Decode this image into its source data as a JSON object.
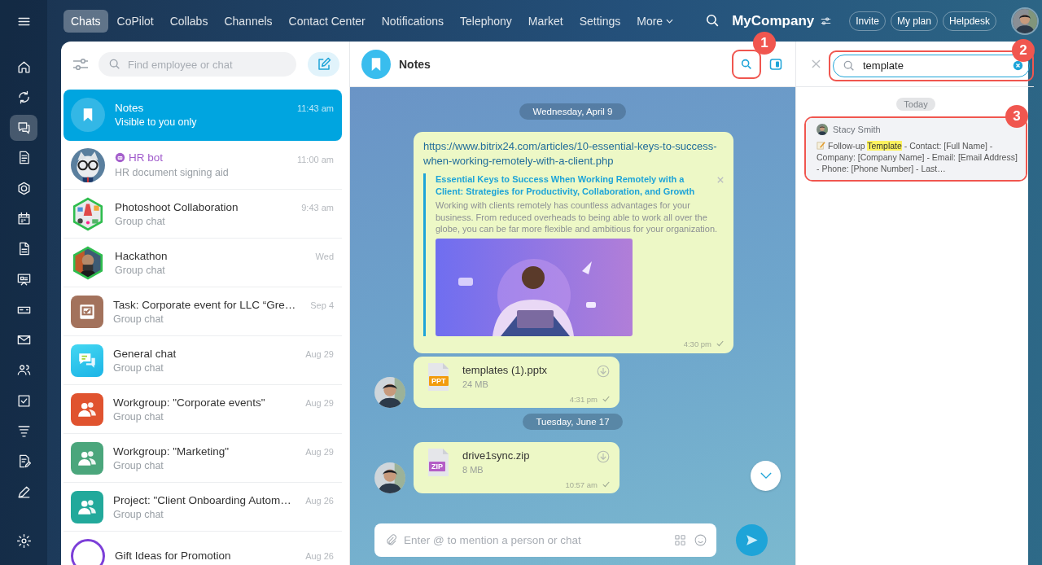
{
  "rail": {
    "items": [
      {
        "kind": "menu",
        "selected": false
      },
      {
        "kind": "home",
        "selected": false
      },
      {
        "kind": "sync",
        "selected": false
      },
      {
        "kind": "chat",
        "selected": true
      },
      {
        "kind": "document",
        "selected": false
      },
      {
        "kind": "hexagon",
        "selected": false
      },
      {
        "kind": "calendar",
        "selected": false
      },
      {
        "kind": "file",
        "selected": false
      },
      {
        "kind": "presentation",
        "selected": false
      },
      {
        "kind": "drive",
        "selected": false
      },
      {
        "kind": "mail",
        "selected": false
      },
      {
        "kind": "people",
        "selected": false
      },
      {
        "kind": "checkbox",
        "selected": false
      },
      {
        "kind": "funnel",
        "selected": false
      },
      {
        "kind": "document-edit",
        "selected": false
      },
      {
        "kind": "pen",
        "selected": false
      },
      {
        "kind": "settings",
        "selected": false
      }
    ]
  },
  "top_nav": {
    "tabs": [
      {
        "label": "Chats",
        "selected": true
      },
      {
        "label": "CoPilot",
        "selected": false
      },
      {
        "label": "Collabs",
        "selected": false
      },
      {
        "label": "Channels",
        "selected": false
      },
      {
        "label": "Contact Center",
        "selected": false
      },
      {
        "label": "Notifications",
        "selected": false
      },
      {
        "label": "Telephony",
        "selected": false
      },
      {
        "label": "Market",
        "selected": false
      },
      {
        "label": "Settings",
        "selected": false
      }
    ],
    "more": "More",
    "company": "MyCompany",
    "buttons": [
      "Invite",
      "My plan",
      "Helpdesk"
    ]
  },
  "chat_list": {
    "search": {
      "placeholder": "Find employee or chat"
    },
    "items": [
      {
        "kind": "notes",
        "title": "Notes",
        "subtitle": "Visible to you only",
        "time": "11:43 am",
        "selected": true
      },
      {
        "kind": "bot",
        "title": "HR bot",
        "subtitle": "HR document signing aid",
        "time": "11:00 am",
        "selected": false
      },
      {
        "kind": "photo-hex",
        "title": "Photoshoot Collaboration",
        "subtitle": "Group chat",
        "time": "9:43 am",
        "selected": false
      },
      {
        "kind": "photo-hex",
        "title": "Hackathon",
        "subtitle": "Group chat",
        "time": "Wed",
        "selected": false
      },
      {
        "kind": "task",
        "color": "#a3725c",
        "title": "Task: Corporate event for LLC “Gre…",
        "subtitle": "Group chat",
        "time": "Sep 4",
        "selected": false
      },
      {
        "kind": "chat-tile",
        "title": "General chat",
        "subtitle": "Group chat",
        "time": "Aug 29",
        "selected": false
      },
      {
        "kind": "group",
        "color": "#e0532f",
        "title": "Workgroup: \"Corporate events\"",
        "subtitle": "Group chat",
        "time": "Aug 29",
        "selected": false
      },
      {
        "kind": "group",
        "color": "#4ba67c",
        "title": "Workgroup: \"Marketing\"",
        "subtitle": "Group chat",
        "time": "Aug 29",
        "selected": false
      },
      {
        "kind": "group",
        "color": "#22a99b",
        "title": "Project: \"Client Onboarding Autom…",
        "subtitle": "Group chat",
        "time": "Aug 26",
        "selected": false
      },
      {
        "kind": "gift",
        "color": "#7c3fd8",
        "title": "Gift Ideas for Promotion",
        "time": "Aug 26",
        "selected": false
      }
    ]
  },
  "chat": {
    "title": "Notes",
    "search_callout": "1",
    "messages": [
      {
        "kind": "date",
        "text": "Wednesday, April 9"
      },
      {
        "kind": "link",
        "url": "https://www.bitrix24.com/articles/10-essential-keys-to-success-when-working-remotely-with-a-client.php",
        "preview_title": "Essential Keys to Success When Working Remotely with a Client: Strategies for Productivity, Collaboration, and Growth",
        "preview_text": "Working with clients remotely has countless advantages for your business. From reduced overheads to being able to work all over the globe, you can be far more flexible and ambitious for your organization.",
        "time": "4:30 pm",
        "read": true
      },
      {
        "kind": "file",
        "name": "templates (1).pptx",
        "size": "24 MB",
        "ext": "PPT",
        "color": "#f29c0e",
        "time": "4:31 pm",
        "read": true
      },
      {
        "kind": "date",
        "text": "Tuesday, June 17"
      },
      {
        "kind": "file",
        "name": "drive1sync.zip",
        "size": "8 MB",
        "ext": "ZIP",
        "color": "#b45ec6",
        "time": "10:57 am",
        "read": true
      }
    ],
    "input": {
      "placeholder": "Enter @ to mention a person or chat"
    }
  },
  "search_panel": {
    "query": "template",
    "callout": "2",
    "date": "Today",
    "results": [
      {
        "author": "Stacy Smith",
        "before": "Follow-up ",
        "match": "Template",
        "after": " - Contact: [Full Name] - Company: [Company Name] - Email: [Email Address] - Phone: [Phone Number] - Last…",
        "callout": "3"
      }
    ]
  }
}
